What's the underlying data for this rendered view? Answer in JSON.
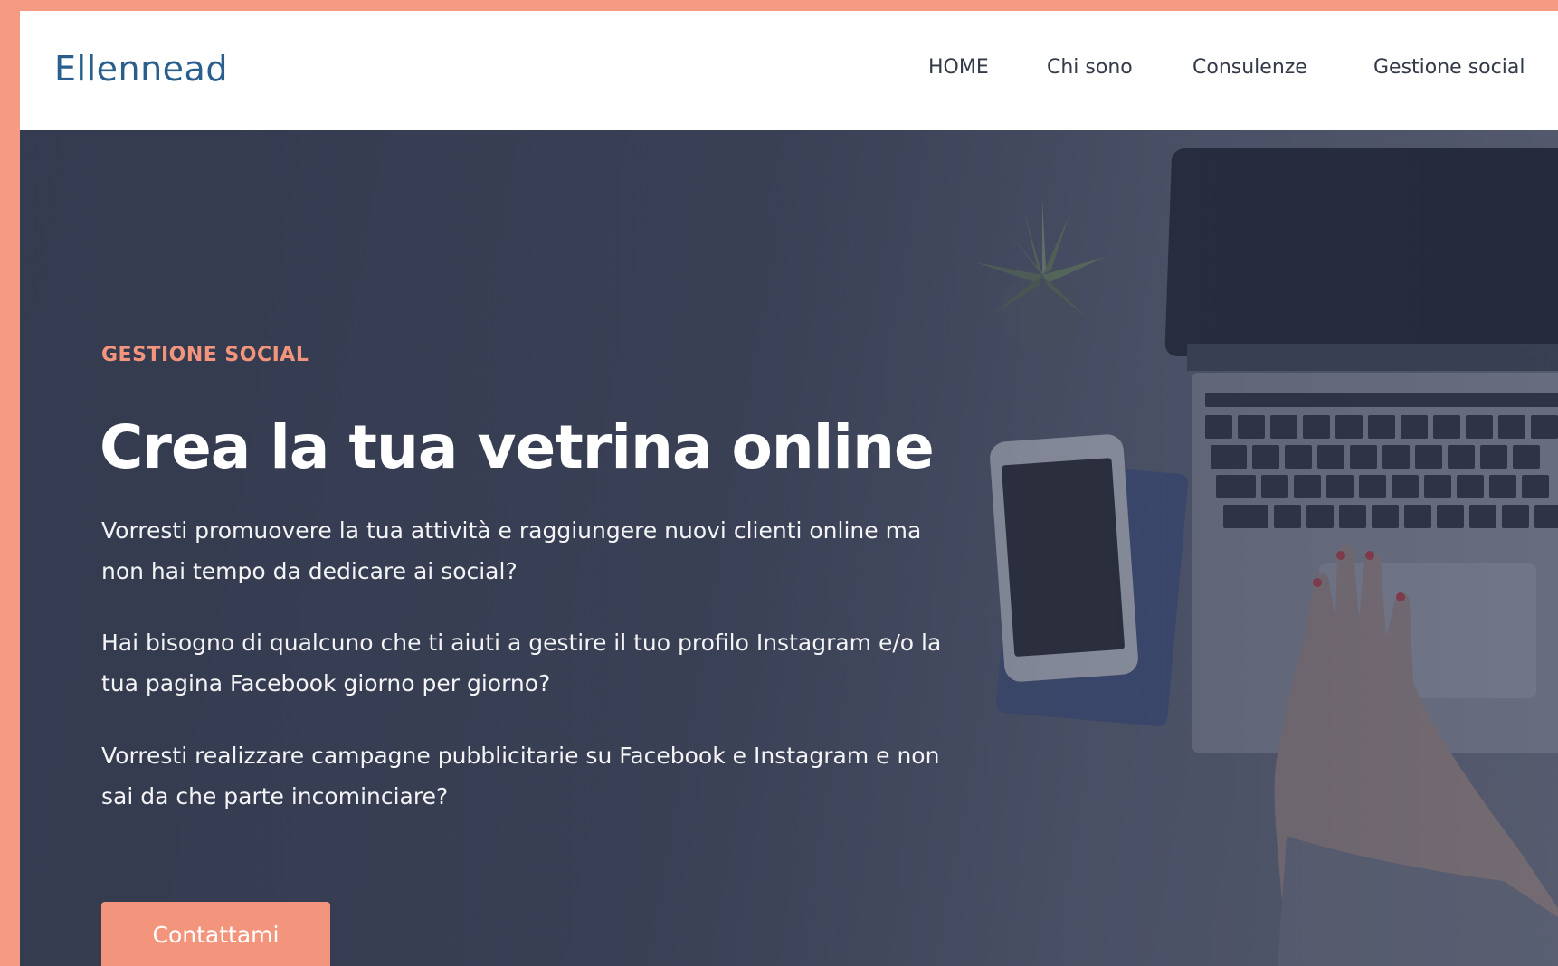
{
  "brand": {
    "logo_text": "Ellennead",
    "logo_color": "#2a5f8d",
    "accent": "#f3957d",
    "page_border": "#f59b84"
  },
  "nav": {
    "items": [
      {
        "label": "HOME"
      },
      {
        "label": "Chi sono"
      },
      {
        "label": "Consulenze"
      },
      {
        "label": "Gestione social"
      }
    ]
  },
  "hero": {
    "eyebrow": "GESTIONE SOCIAL",
    "title": "Crea la tua vetrina online",
    "paragraphs": [
      "Vorresti promuovere la tua attività e raggiungere nuovi clienti online ma non hai tempo da dedicare ai social?",
      "Hai bisogno di qualcuno che ti aiuti a gestire il tuo profilo Instagram e/o la tua pagina Facebook giorno per giorno?",
      "Vorresti realizzare campagne pubblicitarie su Facebook e Instagram e non sai da che parte incominciare?"
    ],
    "cta_label": "Contattami"
  }
}
